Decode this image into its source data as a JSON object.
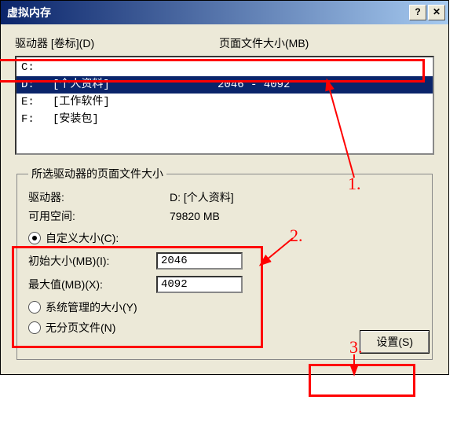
{
  "window": {
    "title": "虚拟内存"
  },
  "header": {
    "drive_col": "驱动器 [卷标](D)",
    "size_col": "页面文件大小(MB)"
  },
  "drive_list": [
    {
      "drv": "C:",
      "vol": "",
      "size": ""
    },
    {
      "drv": "D:",
      "vol": "[个人资料]",
      "size": "2046 - 4092",
      "selected": true
    },
    {
      "drv": "E:",
      "vol": "[工作软件]",
      "size": ""
    },
    {
      "drv": "F:",
      "vol": "[安装包]",
      "size": ""
    }
  ],
  "group": {
    "legend": "所选驱动器的页面文件大小",
    "drive_label": "驱动器:",
    "drive_value": "D:   [个人资料]",
    "free_label": "可用空间:",
    "free_value": "79820 MB",
    "radio_custom": "自定义大小(C):",
    "initial_label": "初始大小(MB)(I):",
    "initial_value": "2046",
    "max_label": "最大值(MB)(X):",
    "max_value": "4092",
    "radio_system": "系统管理的大小(Y)",
    "radio_none": "无分页文件(N)",
    "set_button": "设置(S)"
  },
  "annotations": {
    "n1": "1.",
    "n2": "2.",
    "n3": "3."
  }
}
